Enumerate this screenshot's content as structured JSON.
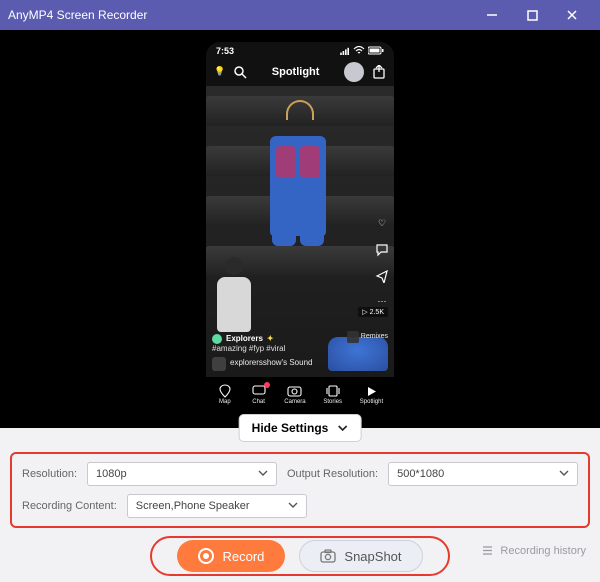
{
  "titlebar": {
    "title": "AnyMP4 Screen Recorder"
  },
  "phone": {
    "time": "7:53",
    "header": {
      "spotlight": "Spotlight"
    },
    "overlay": {
      "explorers": "Explorers",
      "hashtags": "#amazing #fyp #viral",
      "sound": "explorersshow's Sound",
      "remixes": "Remixes",
      "views": "2.5K"
    },
    "nav": {
      "map": "Map",
      "chat": "Chat",
      "camera": "Camera",
      "stories": "Stories",
      "spotlight": "Spotlight"
    }
  },
  "hide_settings": "Hide Settings",
  "settings": {
    "resolution_label": "Resolution:",
    "resolution_value": "1080p",
    "output_label": "Output Resolution:",
    "output_value": "500*1080",
    "content_label": "Recording Content:",
    "content_value": "Screen,Phone Speaker"
  },
  "actions": {
    "record": "Record",
    "snapshot": "SnapShot",
    "history": "Recording history"
  }
}
